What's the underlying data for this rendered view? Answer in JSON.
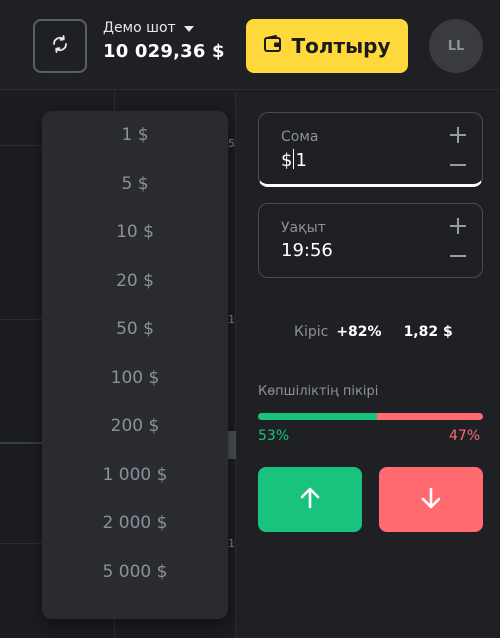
{
  "colors": {
    "accent_yellow": "#ffd93b",
    "buy_green": "#19c37d",
    "sell_red": "#ff6b70",
    "background": "#1c1d21"
  },
  "header": {
    "account_label": "Демо шот",
    "account_balance": "10 029,36 $",
    "deposit_label": "Толтыру",
    "avatar_initials": "LL",
    "switch_icon": "refresh-icon",
    "wallet_icon": "wallet-icon"
  },
  "chart": {
    "axis_ticks": [
      "5",
      "1",
      "1"
    ]
  },
  "amount_dropdown": {
    "options": [
      "1 $",
      "5 $",
      "10 $",
      "20 $",
      "50 $",
      "100 $",
      "200 $",
      "1 000 $",
      "2 000 $",
      "5 000 $"
    ]
  },
  "trade_panel": {
    "amount": {
      "label": "Сома",
      "prefix": "$",
      "value": "1"
    },
    "time": {
      "label": "Уақыт",
      "value": "19:56"
    },
    "profit": {
      "label": "Кіріс",
      "percent": "+82%",
      "amount": "1,82 $"
    },
    "sentiment": {
      "title": "Көпшіліктің пікірі",
      "buy_percent": 53,
      "buy_label": "53%",
      "sell_label": "47%"
    },
    "up_icon": "arrow-up-icon",
    "down_icon": "arrow-down-icon"
  }
}
